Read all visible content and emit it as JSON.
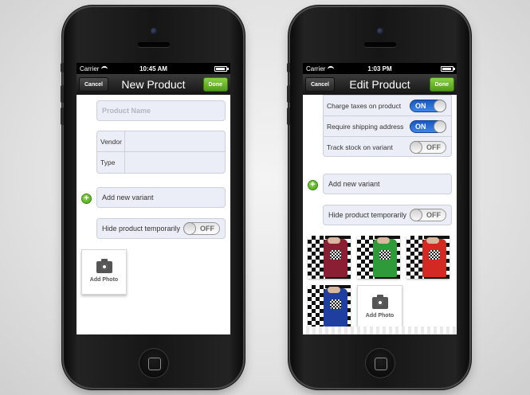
{
  "left_phone": {
    "status": {
      "carrier": "Carrier",
      "time": "10:45 AM"
    },
    "nav": {
      "cancel": "Cancel",
      "title": "New Product",
      "done": "Done"
    },
    "form": {
      "product_name_placeholder": "Product Name",
      "vendor_label": "Vendor",
      "type_label": "Type",
      "add_variant": "Add new variant",
      "hide_product": "Hide product temporarily",
      "hide_toggle": "OFF",
      "add_photo": "Add Photo"
    }
  },
  "right_phone": {
    "status": {
      "carrier": "Carrier",
      "time": "1:03 PM"
    },
    "nav": {
      "cancel": "Cancel",
      "title": "Edit Product",
      "done": "Done"
    },
    "settings": [
      {
        "label": "Charge taxes on product",
        "toggle": "ON"
      },
      {
        "label": "Require shipping address",
        "toggle": "ON"
      },
      {
        "label": "Track stock on variant",
        "toggle": "OFF"
      }
    ],
    "form": {
      "add_variant": "Add new variant",
      "hide_product": "Hide product temporarily",
      "hide_toggle": "OFF",
      "add_photo": "Add Photo"
    },
    "photos": [
      {
        "icon": "shirt-photo",
        "color": "#8a1f33"
      },
      {
        "icon": "shirt-photo",
        "color": "#2f9a3a"
      },
      {
        "icon": "shirt-photo",
        "color": "#d22a22"
      },
      {
        "icon": "shirt-photo",
        "color": "#1f3fa0"
      }
    ]
  },
  "colors": {
    "done_green": "#5fae25",
    "toggle_blue": "#2a6fd6",
    "field_bg": "#eceef7"
  }
}
